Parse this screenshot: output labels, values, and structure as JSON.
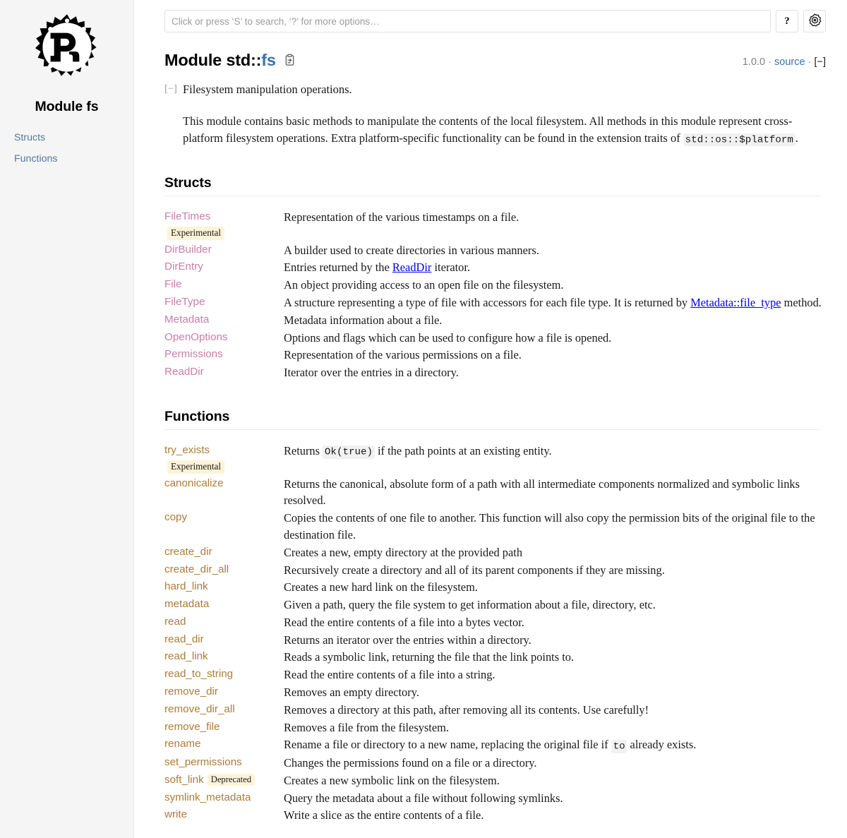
{
  "sidebar": {
    "logo_icon": "rust-logo-icon",
    "title": "Module fs",
    "items": [
      {
        "label": "Structs"
      },
      {
        "label": "Functions"
      }
    ]
  },
  "search": {
    "placeholder": "Click or press ‘S’ to search, ‘?’ for more options…",
    "value": "",
    "help_label": "?",
    "settings_icon": "gear-icon"
  },
  "header": {
    "title_prefix": "Module std::",
    "title_module": "fs",
    "copy_path_icon": "clipboard-copy-icon",
    "version": "1.0.0",
    "separator": "·",
    "source_label": "source",
    "collapse_toggle": "[−]"
  },
  "docblock": {
    "toggle": "[−]",
    "short_description": "Filesystem manipulation operations.",
    "paragraph_part1": "This module contains basic methods to manipulate the contents of the local filesystem. All methods in this module represent cross-platform filesystem operations. Extra platform-specific functionality can be found in the extension traits of ",
    "paragraph_code": "std::os::$platform",
    "paragraph_part2": "."
  },
  "sections": [
    {
      "id": "structs",
      "heading": "Structs",
      "items": [
        {
          "name": "FileTimes",
          "kind": "struct",
          "stability": "Experimental",
          "stability_position": "block",
          "desc_parts": [
            {
              "type": "text",
              "value": "Representation of the various timestamps on a file."
            }
          ]
        },
        {
          "name": "DirBuilder",
          "kind": "struct",
          "desc_parts": [
            {
              "type": "text",
              "value": "A builder used to create directories in various manners."
            }
          ]
        },
        {
          "name": "DirEntry",
          "kind": "struct",
          "desc_parts": [
            {
              "type": "text",
              "value": "Entries returned by the "
            },
            {
              "type": "code-link",
              "value": "ReadDir"
            },
            {
              "type": "text",
              "value": " iterator."
            }
          ]
        },
        {
          "name": "File",
          "kind": "struct",
          "desc_parts": [
            {
              "type": "text",
              "value": "An object providing access to an open file on the filesystem."
            }
          ]
        },
        {
          "name": "FileType",
          "kind": "struct",
          "desc_parts": [
            {
              "type": "text",
              "value": "A structure representing a type of file with accessors for each file type. It is returned by "
            },
            {
              "type": "code-link",
              "value": "Metadata::file_type"
            },
            {
              "type": "text",
              "value": " method."
            }
          ]
        },
        {
          "name": "Metadata",
          "kind": "struct",
          "desc_parts": [
            {
              "type": "text",
              "value": "Metadata information about a file."
            }
          ]
        },
        {
          "name": "OpenOptions",
          "kind": "struct",
          "desc_parts": [
            {
              "type": "text",
              "value": "Options and flags which can be used to configure how a file is opened."
            }
          ]
        },
        {
          "name": "Permissions",
          "kind": "struct",
          "desc_parts": [
            {
              "type": "text",
              "value": "Representation of the various permissions on a file."
            }
          ]
        },
        {
          "name": "ReadDir",
          "kind": "struct",
          "desc_parts": [
            {
              "type": "text",
              "value": "Iterator over the entries in a directory."
            }
          ]
        }
      ]
    },
    {
      "id": "functions",
      "heading": "Functions",
      "items": [
        {
          "name": "try_exists",
          "kind": "fn",
          "stability": "Experimental",
          "stability_position": "block",
          "desc_parts": [
            {
              "type": "text",
              "value": "Returns "
            },
            {
              "type": "code",
              "value": "Ok(true)"
            },
            {
              "type": "text",
              "value": " if the path points at an existing entity."
            }
          ]
        },
        {
          "name": "canonicalize",
          "kind": "fn",
          "desc_parts": [
            {
              "type": "text",
              "value": "Returns the canonical, absolute form of a path with all intermediate components normalized and symbolic links resolved."
            }
          ]
        },
        {
          "name": "copy",
          "kind": "fn",
          "desc_parts": [
            {
              "type": "text",
              "value": "Copies the contents of one file to another. This function will also copy the permission bits of the original file to the destination file."
            }
          ]
        },
        {
          "name": "create_dir",
          "kind": "fn",
          "desc_parts": [
            {
              "type": "text",
              "value": "Creates a new, empty directory at the provided path"
            }
          ]
        },
        {
          "name": "create_dir_all",
          "kind": "fn",
          "desc_parts": [
            {
              "type": "text",
              "value": "Recursively create a directory and all of its parent components if they are missing."
            }
          ]
        },
        {
          "name": "hard_link",
          "kind": "fn",
          "desc_parts": [
            {
              "type": "text",
              "value": "Creates a new hard link on the filesystem."
            }
          ]
        },
        {
          "name": "metadata",
          "kind": "fn",
          "desc_parts": [
            {
              "type": "text",
              "value": "Given a path, query the file system to get information about a file, directory, etc."
            }
          ]
        },
        {
          "name": "read",
          "kind": "fn",
          "desc_parts": [
            {
              "type": "text",
              "value": "Read the entire contents of a file into a bytes vector."
            }
          ]
        },
        {
          "name": "read_dir",
          "kind": "fn",
          "desc_parts": [
            {
              "type": "text",
              "value": "Returns an iterator over the entries within a directory."
            }
          ]
        },
        {
          "name": "read_link",
          "kind": "fn",
          "desc_parts": [
            {
              "type": "text",
              "value": "Reads a symbolic link, returning the file that the link points to."
            }
          ]
        },
        {
          "name": "read_to_string",
          "kind": "fn",
          "desc_parts": [
            {
              "type": "text",
              "value": "Read the entire contents of a file into a string."
            }
          ]
        },
        {
          "name": "remove_dir",
          "kind": "fn",
          "desc_parts": [
            {
              "type": "text",
              "value": "Removes an empty directory."
            }
          ]
        },
        {
          "name": "remove_dir_all",
          "kind": "fn",
          "desc_parts": [
            {
              "type": "text",
              "value": "Removes a directory at this path, after removing all its contents. Use carefully!"
            }
          ]
        },
        {
          "name": "remove_file",
          "kind": "fn",
          "desc_parts": [
            {
              "type": "text",
              "value": "Removes a file from the filesystem."
            }
          ]
        },
        {
          "name": "rename",
          "kind": "fn",
          "desc_parts": [
            {
              "type": "text",
              "value": "Rename a file or directory to a new name, replacing the original file if "
            },
            {
              "type": "code",
              "value": "to"
            },
            {
              "type": "text",
              "value": " already exists."
            }
          ]
        },
        {
          "name": "set_permissions",
          "kind": "fn",
          "desc_parts": [
            {
              "type": "text",
              "value": "Changes the permissions found on a file or a directory."
            }
          ]
        },
        {
          "name": "soft_link",
          "kind": "fn",
          "stability": "Deprecated",
          "stability_position": "inline",
          "desc_parts": [
            {
              "type": "text",
              "value": "Creates a new symbolic link on the filesystem."
            }
          ]
        },
        {
          "name": "symlink_metadata",
          "kind": "fn",
          "desc_parts": [
            {
              "type": "text",
              "value": "Query the metadata about a file without following symlinks."
            }
          ]
        },
        {
          "name": "write",
          "kind": "fn",
          "desc_parts": [
            {
              "type": "text",
              "value": "Write a slice as the entire contents of a file."
            }
          ]
        }
      ]
    }
  ],
  "colors": {
    "sidebar_bg": "#f5f5f5",
    "link": "#3873ad",
    "sidebar_link": "#53789e",
    "struct_link": "#c97daa",
    "fn_link": "#ad7c37",
    "stab_bg": "#fdf3d8",
    "code_bg": "#f1f1f1",
    "code_link_bg": "#eaeefa",
    "border": "#ececec",
    "text": "#1a1a1a",
    "muted": "#808080"
  }
}
